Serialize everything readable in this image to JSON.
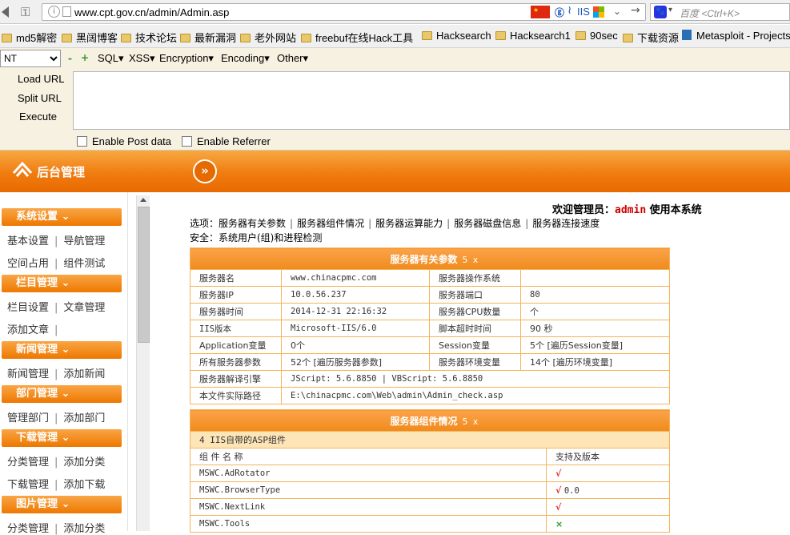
{
  "browser": {
    "url": "www.cpt.gov.cn/admin/Admin.asp",
    "iis_label": "IIS",
    "search_placeholder": "百度 <Ctrl+K>"
  },
  "bookmarks": [
    "md5解密",
    "黑阔博客",
    "技术论坛",
    "最新漏洞",
    "老外网站",
    "freebuf在线Hack工具",
    "Hacksearch",
    "Hacksearch1",
    "90sec",
    "下载资源",
    "Metasploit - Projects"
  ],
  "hackbar": {
    "select_value": "NT",
    "menus": [
      "SQL",
      "XSS",
      "Encryption",
      "Encoding",
      "Other"
    ],
    "buttons": [
      "Load URL",
      "Split URL",
      "Execute"
    ],
    "checkboxes": [
      "Enable Post data",
      "Enable Referrer"
    ]
  },
  "header": {
    "title": "后台管理",
    "toggle": "»"
  },
  "sidebar": {
    "sections": [
      {
        "title": "系统设置",
        "rows": [
          [
            "基本设置",
            "导航管理"
          ],
          [
            "空间占用",
            "组件测试"
          ]
        ]
      },
      {
        "title": "栏目管理",
        "rows": [
          [
            "栏目设置",
            "文章管理"
          ],
          [
            "添加文章",
            ""
          ]
        ]
      },
      {
        "title": "新闻管理",
        "rows": [
          [
            "新闻管理",
            "添加新闻"
          ]
        ]
      },
      {
        "title": "部门管理",
        "rows": [
          [
            "管理部门",
            "添加部门"
          ]
        ]
      },
      {
        "title": "下载管理",
        "rows": [
          [
            "分类管理",
            "添加分类"
          ],
          [
            "下载管理",
            "添加下载"
          ]
        ]
      },
      {
        "title": "图片管理",
        "rows": [
          [
            "分类管理",
            "添加分类"
          ]
        ]
      }
    ]
  },
  "main": {
    "welcome_prefix": "欢迎管理员：",
    "welcome_user": "admin",
    "welcome_suffix": " 使用本系统",
    "options_label": "选项：",
    "options": [
      "服务器有关参数",
      "服务器组件情况",
      "服务器运算能力",
      "服务器磁盘信息",
      "服务器连接速度"
    ],
    "security": "安全：系统用户(组)和进程检测",
    "server_table": {
      "title": "服务器有关参数",
      "close": "5 x",
      "rows": [
        [
          "服务器名",
          "www.chinacpmc.com",
          "服务器操作系统",
          ""
        ],
        [
          "服务器IP",
          "10.0.56.237",
          "服务器端口",
          "80"
        ],
        [
          "服务器时间",
          "2014-12-31 22:16:32",
          "服务器CPU数量",
          "个"
        ],
        [
          "IIS版本",
          "Microsoft-IIS/6.0",
          "脚本超时时间",
          "90 秒"
        ],
        [
          "Application变量",
          "0个",
          "Session变量",
          "5个 [遍历Session变量]"
        ],
        [
          "所有服务器参数",
          "52个 [遍历服务器参数]",
          "服务器环境变量",
          "14个 [遍历环境变量]"
        ]
      ],
      "engine_label": "服务器解译引擎",
      "engine_value": "JScript: 5.6.8850 | VBScript: 5.6.8850",
      "path_label": "本文件实际路径",
      "path_value": "E:\\chinacpmc.com\\Web\\admin\\Admin_check.asp"
    },
    "component_table": {
      "title": "服务器组件情况",
      "close": "5 x",
      "subtitle": "4 IIS自带的ASP组件",
      "col_name": "组 件 名 称",
      "col_support": "支持及版本",
      "rows": [
        {
          "name": "MSWC.AdRotator",
          "mark": "√",
          "version": ""
        },
        {
          "name": "MSWC.BrowserType",
          "mark": "√",
          "version": "0.0"
        },
        {
          "name": "MSWC.NextLink",
          "mark": "√",
          "version": ""
        },
        {
          "name": "MSWC.Tools",
          "mark": "×",
          "version": ""
        }
      ]
    }
  }
}
